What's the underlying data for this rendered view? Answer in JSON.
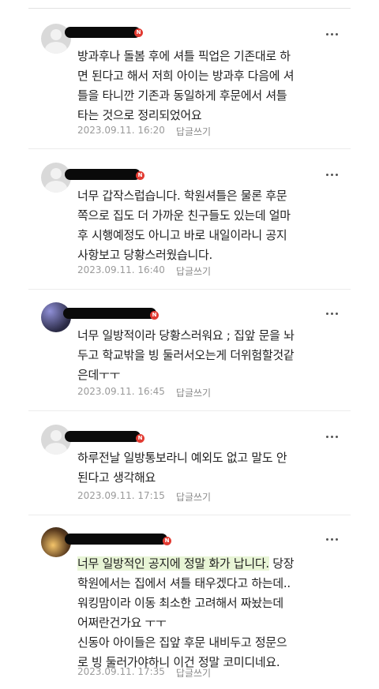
{
  "comments": [
    {
      "text": "방과후나 돌봄 후에 셔틀 픽업은 기존대로 하\n면 된다고 해서 저희 아이는 방과후 다음에 셔\n틀을 타니깐 기존과 동일하게 후문에서 셔틀\n타는 것으로 정리되었어요",
      "time": "2023.09.11. 16:20",
      "reply": "답글쓰기"
    },
    {
      "text": "너무 갑작스럽습니다. 학원셔틀은 물론 후문\n쪽으로 집도 더 가까운 친구들도 있는데 얼마\n후 시행예정도 아니고 바로 내일이라니 공지\n사항보고 당황스러웠습니다.",
      "time": "2023.09.11. 16:40",
      "reply": "답글쓰기"
    },
    {
      "text": "너무 일방적이라 당황스러워요 ; 집앞 문을 놔\n두고 학교밖을 빙 둘러서오는게 더위험할것같\n은데ㅜㅜ",
      "time": "2023.09.11. 16:45",
      "reply": "답글쓰기"
    },
    {
      "text": "하루전날 일방통보라니 예외도 없고 말도 안\n된다고 생각해요",
      "time": "2023.09.11. 17:15",
      "reply": "답글쓰기"
    },
    {
      "text_highlight": "너무 일방적인 공지에 정말 화가 납니다.",
      "text": " 당장\n학원에서는 집에서 셔틀 태우겠다고 하는데..\n워킹맘이라 이동 최소한 고려해서 짜놨는데\n어쩌란건가요 ㅜㅜ\n신동아 아이들은 집앞 후문 내비두고 정문으\n로 빙 둘러가야하니 이건 정말 코미디네요.",
      "time": "2023.09.11. 17:35",
      "reply": "답글쓰기"
    }
  ],
  "badge_letter": "N",
  "icons": {
    "avatar": "default-profile-icon",
    "more": "more-options-icon",
    "badge": "new-badge-icon"
  },
  "colors": {
    "badge": "#e23b32",
    "highlight": "#e8f5d6",
    "meta": "#9a9a9a"
  }
}
